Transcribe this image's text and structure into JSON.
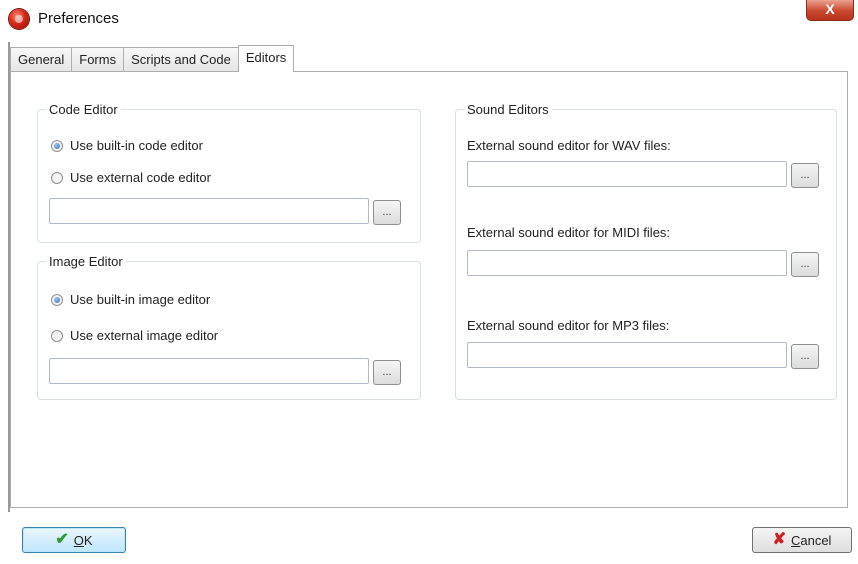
{
  "window": {
    "title": "Preferences",
    "close_glyph": "X"
  },
  "tabs": [
    {
      "label": "General",
      "active": false
    },
    {
      "label": "Forms",
      "active": false
    },
    {
      "label": "Scripts and Code",
      "active": false
    },
    {
      "label": "Editors",
      "active": true
    }
  ],
  "code_editor": {
    "legend": "Code Editor",
    "option_builtin": "Use built-in code editor",
    "option_external": "Use external code editor",
    "selected": "builtin",
    "path_value": "",
    "browse_label": "..."
  },
  "image_editor": {
    "legend": "Image Editor",
    "option_builtin": "Use built-in image editor",
    "option_external": "Use external image editor",
    "selected": "builtin",
    "path_value": "",
    "browse_label": "..."
  },
  "sound_editors": {
    "legend": "Sound Editors",
    "wav_label": "External sound editor for WAV files:",
    "wav_value": "",
    "midi_label": "External sound editor for MIDI files:",
    "midi_value": "",
    "mp3_label": "External sound editor for MP3 files:",
    "mp3_value": "",
    "browse_label": "..."
  },
  "buttons": {
    "ok_mnemonic": "O",
    "ok_rest": "K",
    "cancel_mnemonic": "C",
    "cancel_rest": "ancel"
  },
  "icons": {
    "app": "app-logo-icon",
    "ok": "checkmark-icon",
    "cancel": "cross-icon"
  },
  "colors": {
    "ok_check": "#2e9a2e",
    "cancel_x": "#d02020",
    "close_button": "#c9472f"
  }
}
